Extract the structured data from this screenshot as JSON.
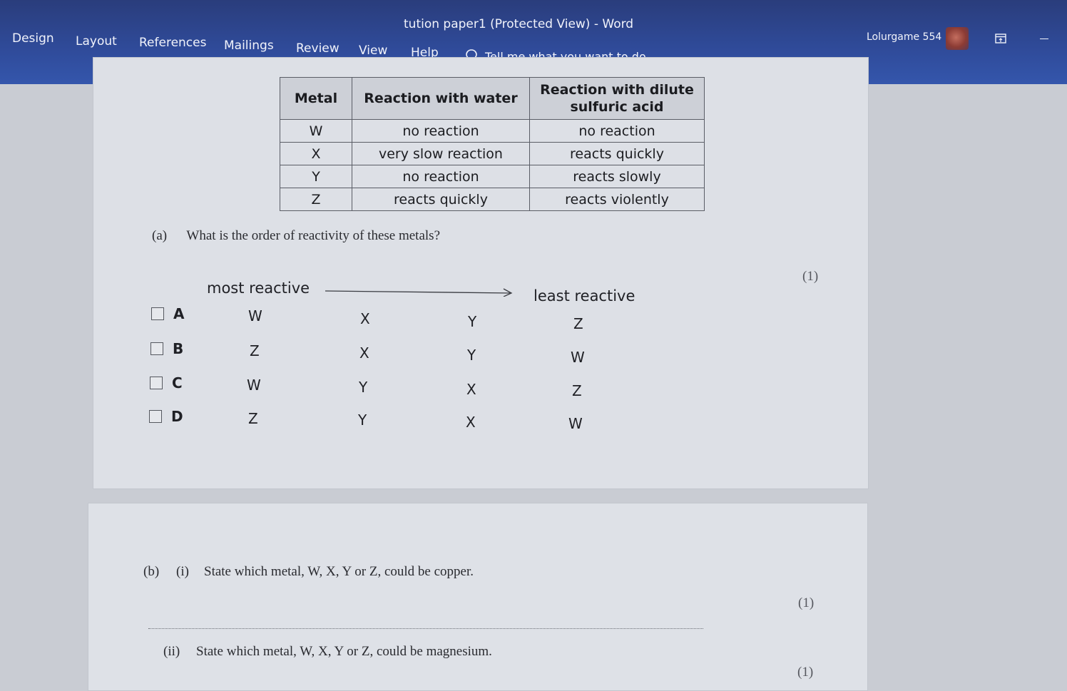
{
  "window": {
    "title": "tution paper1 (Protected View)  -  Word",
    "user_name": "Lolurgame 554"
  },
  "ribbon": {
    "tabs": [
      "Design",
      "Layout",
      "References",
      "Mailings",
      "Review",
      "View",
      "Help"
    ],
    "tell_me": "Tell me what you want to do"
  },
  "table": {
    "headers": [
      "Metal",
      "Reaction with water",
      "Reaction with dilute sulfuric acid"
    ],
    "rows": [
      [
        "W",
        "no reaction",
        "no reaction"
      ],
      [
        "X",
        "very slow reaction",
        "reacts quickly"
      ],
      [
        "Y",
        "no reaction",
        "reacts slowly"
      ],
      [
        "Z",
        "reacts quickly",
        "reacts violently"
      ]
    ]
  },
  "question_a": {
    "label": "(a)",
    "text": "What is the order of reactivity of these metals?",
    "marks": "(1)",
    "most_reactive": "most reactive",
    "least_reactive": "least reactive",
    "options": [
      {
        "letter": "A",
        "order": [
          "W",
          "X",
          "Y",
          "Z"
        ]
      },
      {
        "letter": "B",
        "order": [
          "Z",
          "X",
          "Y",
          "W"
        ]
      },
      {
        "letter": "C",
        "order": [
          "W",
          "Y",
          "X",
          "Z"
        ]
      },
      {
        "letter": "D",
        "order": [
          "Z",
          "Y",
          "X",
          "W"
        ]
      }
    ]
  },
  "question_b": {
    "label": "(b)",
    "part_i_label": "(i)",
    "part_i_text": "State which metal, W, X, Y or Z, could be copper.",
    "part_i_marks": "(1)",
    "part_ii_label": "(ii)",
    "part_ii_text": "State which metal, W, X, Y or Z, could be magnesium.",
    "part_ii_marks": "(1)"
  }
}
